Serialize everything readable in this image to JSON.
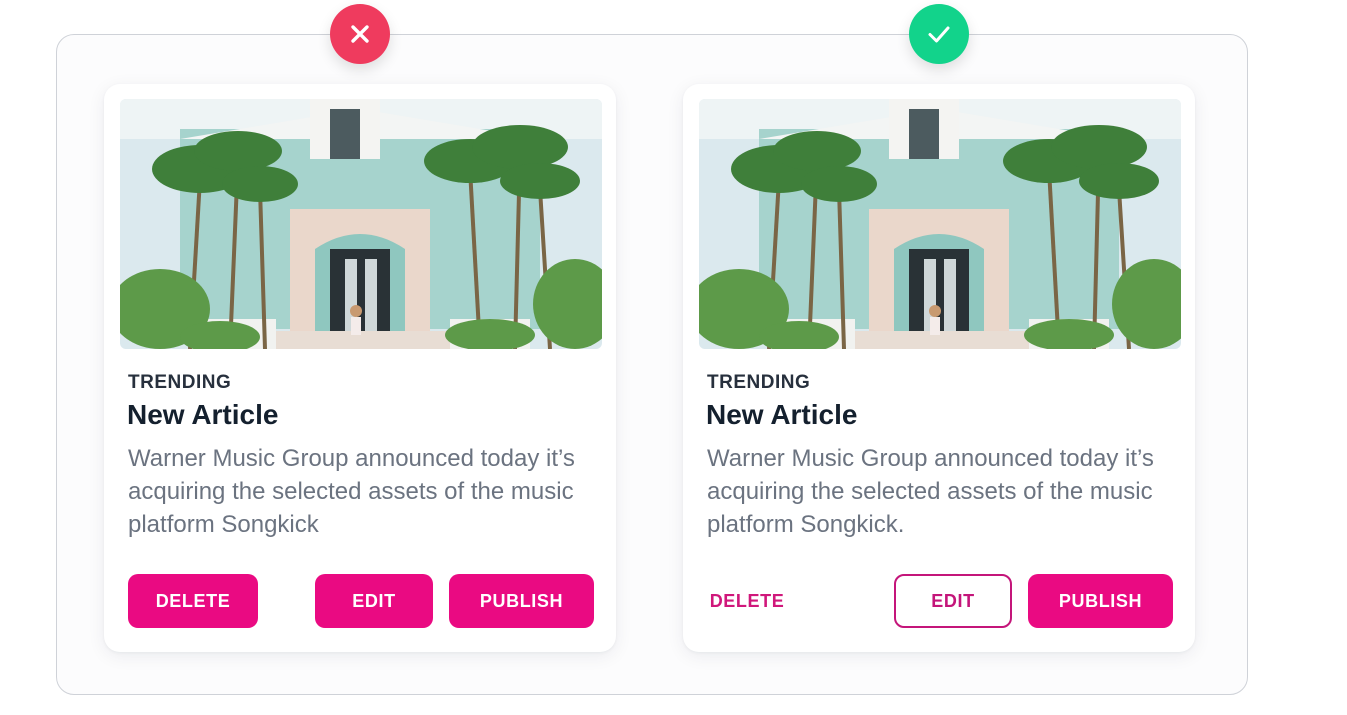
{
  "colors": {
    "accent": "#ea0a82",
    "bad_badge": "#ef3b5e",
    "good_badge": "#12d38b"
  },
  "bad_example": {
    "badge_icon": "close-icon",
    "card": {
      "eyebrow": "TRENDING",
      "title": "New Article",
      "body": "Warner Music Group announced today it’s acquiring the selected assets of the music platform Songkick",
      "delete_label": "DELETE",
      "edit_label": "EDIT",
      "publish_label": "PUBLISH"
    }
  },
  "good_example": {
    "badge_icon": "check-icon",
    "card": {
      "eyebrow": "TRENDING",
      "title": "New Article",
      "body": "Warner Music Group announced today it’s acquiring the selected assets of the music platform Songkick.",
      "delete_label": "DELETE",
      "edit_label": "EDIT",
      "publish_label": "PUBLISH"
    }
  }
}
